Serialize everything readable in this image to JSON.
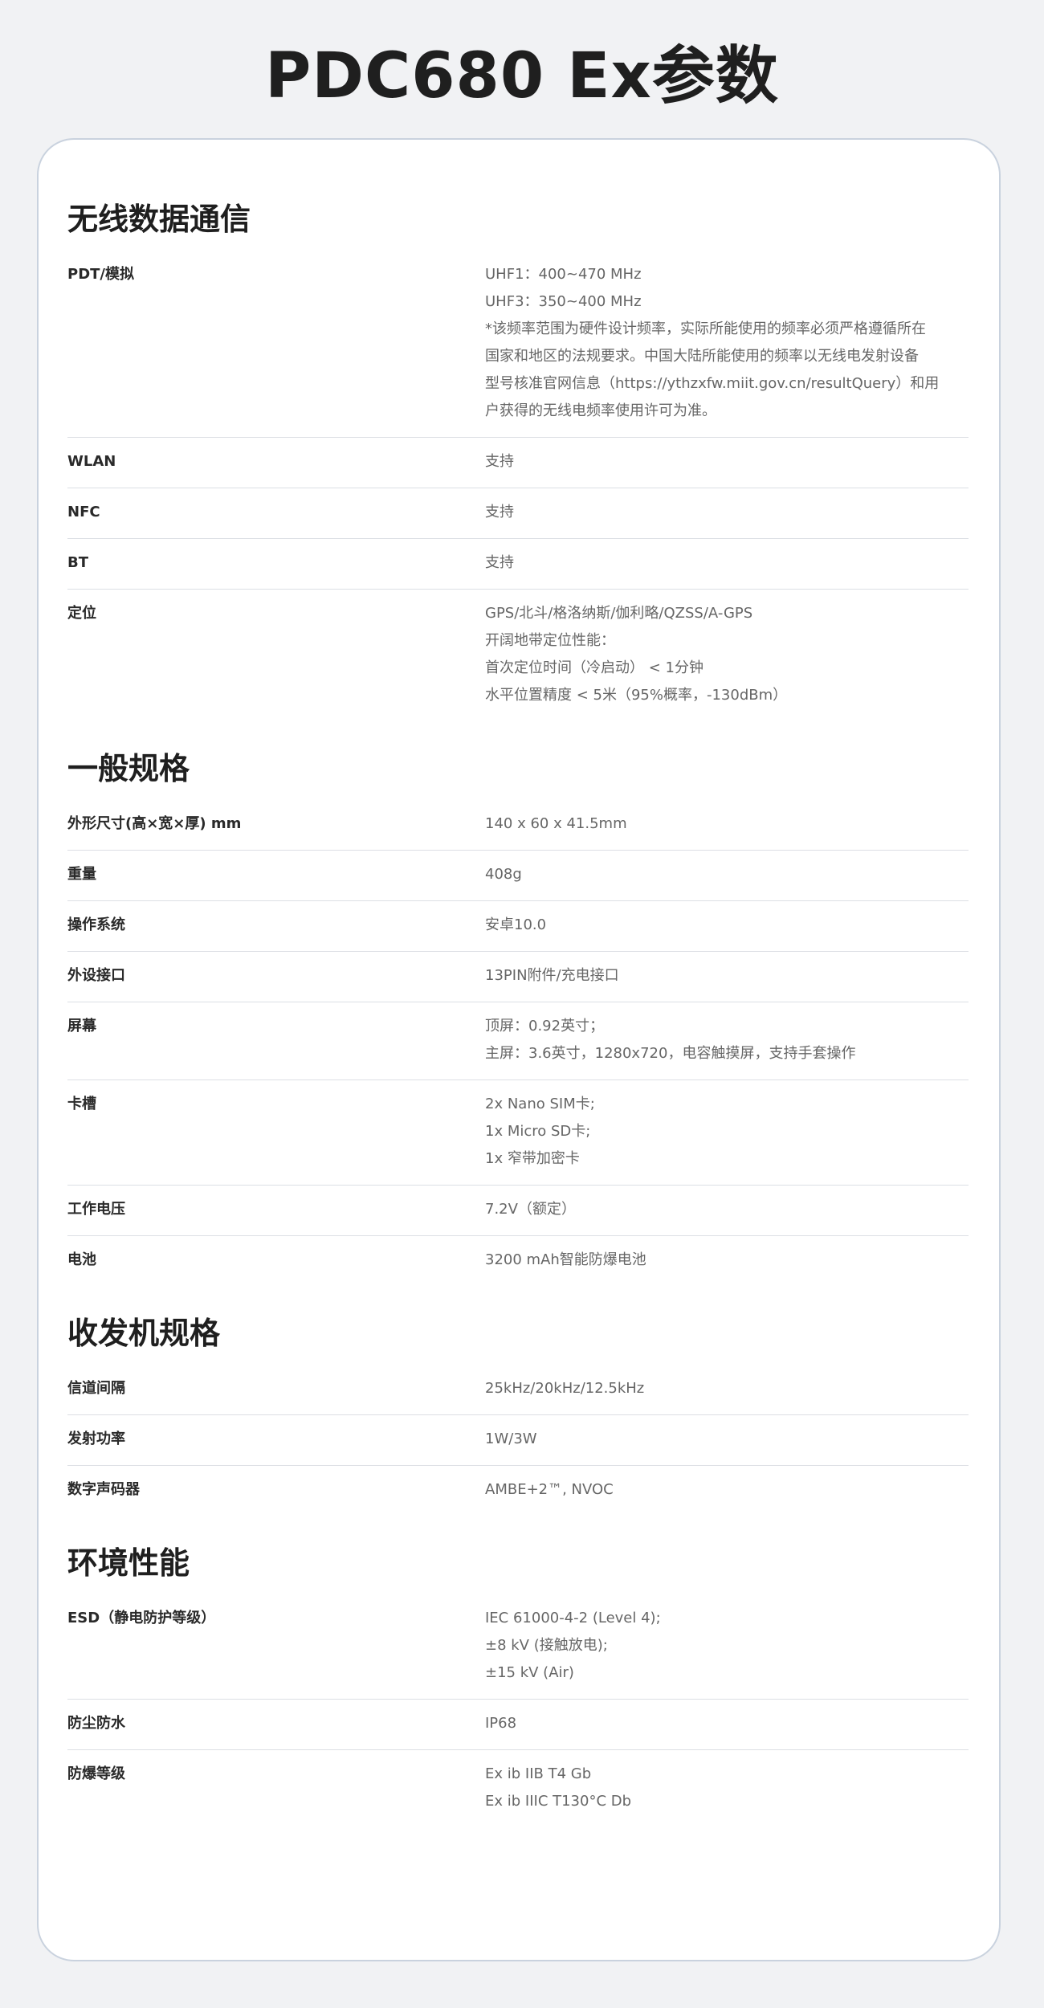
{
  "page": {
    "title": "PDC680 Ex参数"
  },
  "sections": [
    {
      "title": "无线数据通信",
      "rows": [
        {
          "key": "PDT/模拟",
          "values": [
            "UHF1：400~470 MHz",
            "UHF3：350~400 MHz",
            "*该频率范围为硬件设计频率，实际所能使用的频率必须严格遵循所在",
            "国家和地区的法规要求。中国大陆所能使用的频率以无线电发射设备",
            "型号核准官网信息（https://ythzxfw.miit.gov.cn/resultQuery）和用",
            "户获得的无线电频率使用许可为准。"
          ]
        },
        {
          "key": "WLAN",
          "values": [
            "支持"
          ]
        },
        {
          "key": "NFC",
          "values": [
            "支持"
          ]
        },
        {
          "key": "BT",
          "values": [
            "支持"
          ]
        },
        {
          "key": "定位",
          "values": [
            "GPS/北斗/格洛纳斯/伽利略/QZSS/A-GPS",
            "开阔地带定位性能：",
            "首次定位时间（冷启动） < 1分钟",
            "水平位置精度 < 5米（95%概率，-130dBm）"
          ]
        }
      ]
    },
    {
      "title": "一般规格",
      "rows": [
        {
          "key": "外形尺寸(高×宽×厚) mm",
          "values": [
            "140 x 60 x 41.5mm"
          ]
        },
        {
          "key": "重量",
          "values": [
            "408g"
          ]
        },
        {
          "key": "操作系统",
          "values": [
            "安卓10.0"
          ]
        },
        {
          "key": "外设接口",
          "values": [
            "13PIN附件/充电接口"
          ]
        },
        {
          "key": "屏幕",
          "values": [
            "顶屏：0.92英寸；",
            "主屏：3.6英寸，1280x720，电容触摸屏，支持手套操作"
          ]
        },
        {
          "key": "卡槽",
          "values": [
            "2x Nano SIM卡;",
            "1x Micro SD卡;",
            "1x 窄带加密卡"
          ]
        },
        {
          "key": "工作电压",
          "values": [
            "7.2V（额定）"
          ]
        },
        {
          "key": "电池",
          "values": [
            "3200 mAh智能防爆电池"
          ]
        }
      ]
    },
    {
      "title": "收发机规格",
      "rows": [
        {
          "key": "信道间隔",
          "values": [
            "25kHz/20kHz/12.5kHz"
          ]
        },
        {
          "key": "发射功率",
          "values": [
            "1W/3W"
          ]
        },
        {
          "key": "数字声码器",
          "values": [
            "AMBE+2™, NVOC"
          ]
        }
      ]
    },
    {
      "title": "环境性能",
      "rows": [
        {
          "key": "ESD（静电防护等级）",
          "values": [
            "IEC 61000-4-2 (Level 4);",
            "±8 kV (接触放电);",
            "±15 kV (Air)"
          ]
        },
        {
          "key": "防尘防水",
          "values": [
            "IP68"
          ]
        },
        {
          "key": "防爆等级",
          "values": [
            "Ex ib IIB T4 Gb",
            "Ex ib IIIC T130°C Db"
          ]
        }
      ]
    }
  ]
}
